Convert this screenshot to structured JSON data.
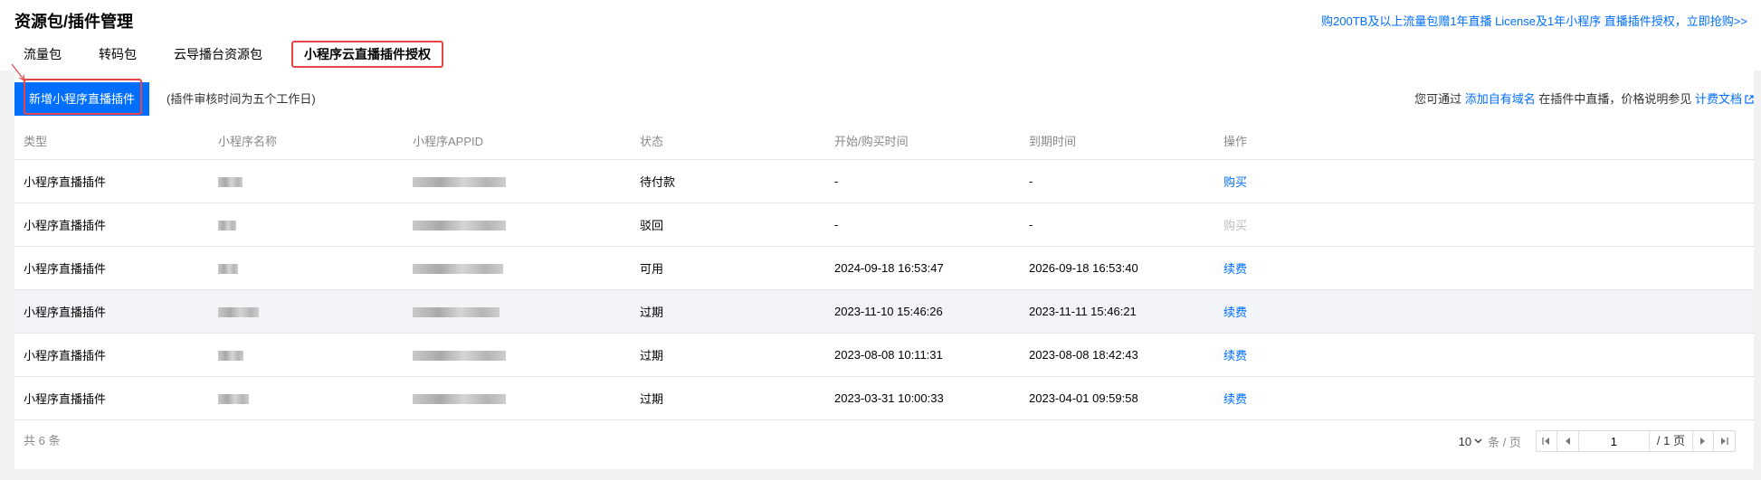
{
  "header": {
    "title": "资源包/插件管理",
    "promo": "购200TB及以上流量包赠1年直播 License及1年小程序 直播插件授权，立即抢购>>"
  },
  "tabs": [
    {
      "label": "流量包"
    },
    {
      "label": "转码包"
    },
    {
      "label": "云导播台资源包"
    },
    {
      "label": "小程序云直播插件授权"
    }
  ],
  "toolbar": {
    "new_button": "新增小程序直播插件",
    "review_note": "(插件审核时间为五个工作日)",
    "note_prefix": "您可通过",
    "note_link": "添加自有域名",
    "note_middle": "在插件中直播，价格说明参见",
    "note_doc_link": "计费文档"
  },
  "table": {
    "headers": [
      "类型",
      "小程序名称",
      "小程序APPID",
      "状态",
      "开始/购买时间",
      "到期时间",
      "操作"
    ],
    "rows": [
      {
        "type": "小程序直播插件",
        "status": "待付款",
        "start": "-",
        "end": "-",
        "action": "购买"
      },
      {
        "type": "小程序直播插件",
        "status": "驳回",
        "start": "-",
        "end": "-",
        "action": "购买"
      },
      {
        "type": "小程序直播插件",
        "status": "可用",
        "start": "2024-09-18 16:53:47",
        "end": "2026-09-18 16:53:40",
        "action": "续费"
      },
      {
        "type": "小程序直播插件",
        "status": "过期",
        "start": "2023-11-10 15:46:26",
        "end": "2023-11-11 15:46:21",
        "action": "续费"
      },
      {
        "type": "小程序直播插件",
        "status": "过期",
        "start": "2023-08-08 10:11:31",
        "end": "2023-08-08 18:42:43",
        "action": "续费"
      },
      {
        "type": "小程序直播插件",
        "status": "过期",
        "start": "2023-03-31 10:00:33",
        "end": "2023-04-01 09:59:58",
        "action": "续费"
      }
    ]
  },
  "footer": {
    "total": "共 6 条",
    "page_size": "10",
    "per_page": "条 / 页",
    "current_page": "1",
    "total_pages": "/ 1 页"
  },
  "colors": {
    "accent": "#006eff",
    "highlight": "#e54545"
  }
}
